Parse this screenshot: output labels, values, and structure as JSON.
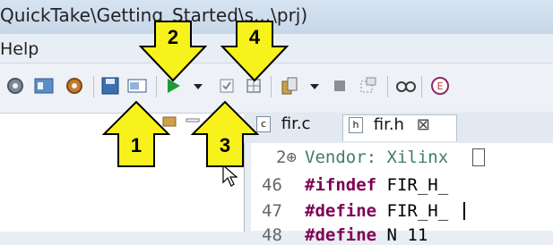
{
  "window": {
    "title": "QuickTake\\Getting_Started\\s...\\prj)"
  },
  "menu": {
    "help": "Help"
  },
  "toolbar": {
    "icons": [
      "gear-icon",
      "debug-config-icon",
      "build-settings-icon",
      "save-icon",
      "open-file-icon",
      "run-icon",
      "dropdown-icon",
      "checkbox-icon",
      "grid-icon",
      "copy-icon",
      "dropdown2-icon",
      "stop-icon",
      "window-icon",
      "glasses-icon",
      "bug-icon"
    ]
  },
  "annotations": [
    {
      "label": "1"
    },
    {
      "label": "2"
    },
    {
      "label": "3"
    },
    {
      "label": "4"
    }
  ],
  "tabs": [
    {
      "label": "fir.c",
      "active": false
    },
    {
      "label": "fir.h",
      "active": true,
      "close": "⊠"
    }
  ],
  "editor": {
    "lines": [
      {
        "num": "2⊕",
        "keyword": "",
        "text": "Vendor: Xilinx",
        "is_comment": true
      },
      {
        "num": "46",
        "keyword": "#ifndef",
        "text": " FIR_H_",
        "is_comment": false
      },
      {
        "num": "47",
        "keyword": "#define",
        "text": " FIR_H_",
        "is_comment": false
      },
      {
        "num": "48",
        "keyword": "#define",
        "text": " N   11",
        "is_comment": false
      }
    ]
  },
  "colors": {
    "arrow": "#f7f21b",
    "keyword": "#7f0055",
    "comment": "#3f7f5f"
  }
}
